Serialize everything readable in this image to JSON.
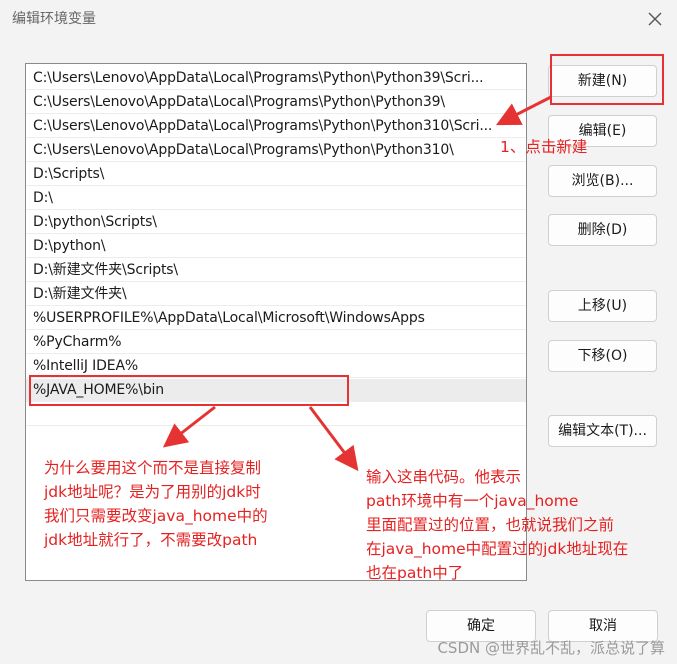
{
  "dialog": {
    "title": "编辑环境变量"
  },
  "paths": [
    "C:\\Users\\Lenovo\\AppData\\Local\\Programs\\Python\\Python39\\Scri...",
    "C:\\Users\\Lenovo\\AppData\\Local\\Programs\\Python\\Python39\\",
    "C:\\Users\\Lenovo\\AppData\\Local\\Programs\\Python\\Python310\\Scri...",
    "C:\\Users\\Lenovo\\AppData\\Local\\Programs\\Python\\Python310\\",
    "D:\\Scripts\\",
    "D:\\",
    "D:\\python\\Scripts\\",
    "D:\\python\\",
    "D:\\新建文件夹\\Scripts\\",
    "D:\\新建文件夹\\",
    "%USERPROFILE%\\AppData\\Local\\Microsoft\\WindowsApps",
    "%PyCharm%",
    "%IntelliJ IDEA%",
    "%JAVA_HOME%\\bin"
  ],
  "buttons": {
    "new": "新建(N)",
    "edit": "编辑(E)",
    "browse": "浏览(B)...",
    "delete": "删除(D)",
    "move_up": "上移(U)",
    "move_down": "下移(O)",
    "edit_text": "编辑文本(T)...",
    "ok": "确定",
    "cancel": "取消"
  },
  "annotations": {
    "click_new": "1、点击新建",
    "why": [
      "为什么要用这个而不是直接复制",
      "jdk地址呢？是为了用别的jdk时",
      "我们只需要改变java_home中的",
      "jdk地址就行了，不需要改path"
    ],
    "input": [
      "输入这串代码。他表示",
      "path环境中有一个java_home",
      "里面配置过的位置，也就说我们之前",
      "在java_home中配置过的jdk地址现在",
      "也在path中了"
    ]
  },
  "watermark": "CSDN @世界乱不乱，派总说了算",
  "colors": {
    "annotation": "#e53333",
    "background": "#f3f3f3"
  }
}
